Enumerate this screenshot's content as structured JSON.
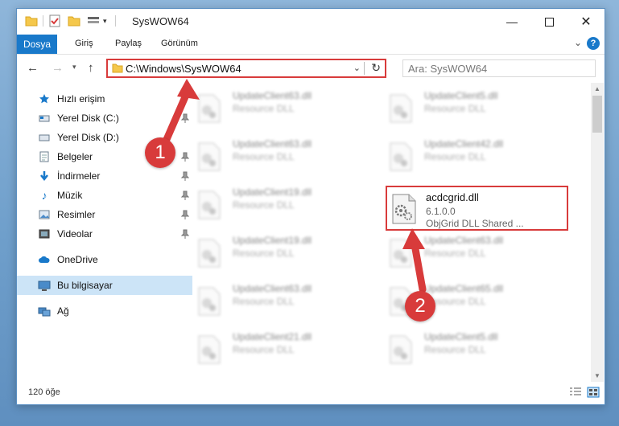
{
  "window": {
    "title": "SysWOW64"
  },
  "ribbon": {
    "tabs": [
      "Dosya",
      "Giriş",
      "Paylaş",
      "Görünüm"
    ]
  },
  "address": {
    "path": "C:\\Windows\\SysWOW64"
  },
  "search": {
    "placeholder": "Ara: SysWOW64"
  },
  "sidebar": {
    "items": [
      {
        "label": "Hızlı erişim",
        "icon": "star-icon"
      },
      {
        "label": "Yerel Disk (C:)",
        "icon": "drive-icon",
        "pinned": true
      },
      {
        "label": "Yerel Disk (D:)",
        "icon": "drive-icon"
      },
      {
        "label": "Belgeler",
        "icon": "documents-icon",
        "pinned": true
      },
      {
        "label": "İndirmeler",
        "icon": "download-icon",
        "pinned": true
      },
      {
        "label": "Müzik",
        "icon": "music-icon",
        "pinned": true
      },
      {
        "label": "Resimler",
        "icon": "pictures-icon",
        "pinned": true
      },
      {
        "label": "Videolar",
        "icon": "videos-icon",
        "pinned": true
      },
      {
        "label": "OneDrive",
        "icon": "cloud-icon"
      },
      {
        "label": "Bu bilgisayar",
        "icon": "computer-icon",
        "selected": true
      },
      {
        "label": "Ağ",
        "icon": "network-icon"
      }
    ]
  },
  "files": {
    "left": [
      {
        "name": "UpdateClient63.dll",
        "desc": "Resource DLL"
      },
      {
        "name": "UpdateClient63.dll",
        "desc": "Resource DLL"
      },
      {
        "name": "UpdateClient19.dll",
        "desc": "Resource DLL"
      },
      {
        "name": "UpdateClient19.dll",
        "desc": "Resource DLL"
      },
      {
        "name": "UpdateClient63.dll",
        "desc": "Resource DLL"
      },
      {
        "name": "UpdateClient21.dll",
        "desc": "Resource DLL"
      }
    ],
    "right": [
      {
        "name": "UpdateClient5.dll",
        "desc": "Resource DLL"
      },
      {
        "name": "UpdateClient42.dll",
        "desc": "Resource DLL"
      },
      {
        "name": "UpdateClient63.dll",
        "desc": "Resource DLL"
      },
      {
        "name": "UpdateClient65.dll",
        "desc": "Resource DLL"
      },
      {
        "name": "UpdateClient5.dll",
        "desc": "Resource DLL"
      }
    ],
    "selected": {
      "name": "acdcgrid.dll",
      "version": "6.1.0.0",
      "desc": "ObjGrid DLL Shared ..."
    }
  },
  "status": {
    "count": "120 öğe"
  },
  "annotations": {
    "step1": "1",
    "step2": "2"
  },
  "colors": {
    "accent": "#1979ca",
    "highlight": "#d83b3b",
    "selection": "#cce4f7"
  }
}
